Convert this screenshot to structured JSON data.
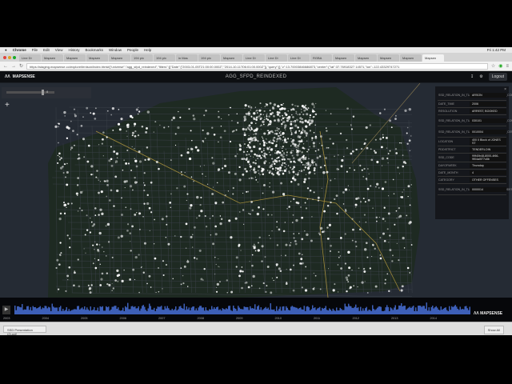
{
  "menubar": {
    "items": [
      "Chrome",
      "File",
      "Edit",
      "View",
      "History",
      "Bookmarks",
      "Window",
      "People",
      "Help"
    ],
    "clock": "Fri 1:42 PM"
  },
  "tabs": [
    "Line Di",
    "Mapsen",
    "Mapsen",
    "Mapsen",
    "Mapsen",
    "194 pix",
    "194 pix",
    "in Mas",
    "194 pix",
    "Mapsen",
    "Line Di",
    "Line Di",
    "Line Di",
    "RGBA",
    "Mapsen",
    "Mapsen",
    "Mapsen",
    "Mapsen",
    "Mapsen"
  ],
  "address": {
    "url": "https://staging.mapsense.co/explore/tenison/index.html#{\"universe\":\"agg_sfpd_reindexed\",\"filters\":[{\"Date\":[\"2003-01-05T21:00:00.000Z\",\"2014-10-11T06:01:00.000Z\"]},\"query\":[],\"z\":13.70003846686873,\"center\":{\"lat\":37.76918327 14571,\"lon\":-122.43329747271"
  },
  "app": {
    "brand": "MAPSENSE",
    "dataset_title": "AGG_SFPD_REINDEXED",
    "logout": "Logout"
  },
  "filter": {
    "value": "8"
  },
  "panel": {
    "rows": [
      {
        "key": "SSD_RELATION_IN_TURB_PUBLIC_SAFE_WORK_CONSOLTE_NTS",
        "value": "ARSON"
      },
      {
        "key": "DATE_TIME",
        "value": "2006"
      },
      {
        "key": "RESOLUTION",
        "value": "ARREST, BOOKED"
      },
      {
        "key": "SSD_RELATION_IN_TURB_PUBLIC_SAFE_WORK_COUNTIES",
        "value": "030101"
      },
      {
        "key": "SSD_RELATION_IN_TURB_PUBLIC_SAFE_WORK_CENSUS_BLOCKS",
        "value": "0010004"
      },
      {
        "key": "LOCATION",
        "value": "400 0 Block of JONES ST"
      },
      {
        "key": "PDDISTRICT",
        "value": "TENDERLOIN"
      },
      {
        "key": "SSD_CODE",
        "value": "99f40b48-8000-4f66-9f04a0f77c8b"
      },
      {
        "key": "DAYOFWEEK",
        "value": "Thursday"
      },
      {
        "key": "DATE_MONTH",
        "value": "4"
      },
      {
        "key": "CATEGORY",
        "value": "OTHER OFFENSES"
      },
      {
        "key": "SSD_RELATION_IN_TURB_PUBLIC_SAFE_ZIP_CODES",
        "value": "0000014"
      }
    ]
  },
  "timeline": {
    "years": [
      "2003",
      "2004",
      "2005",
      "2006",
      "2007",
      "2008",
      "2009",
      "2010",
      "2011",
      "2012",
      "2013",
      "2014"
    ],
    "bar_color": "#3d5fb8"
  },
  "downloads": {
    "file": "SSD Presentation (2).pdf",
    "show_all": "Show All"
  }
}
